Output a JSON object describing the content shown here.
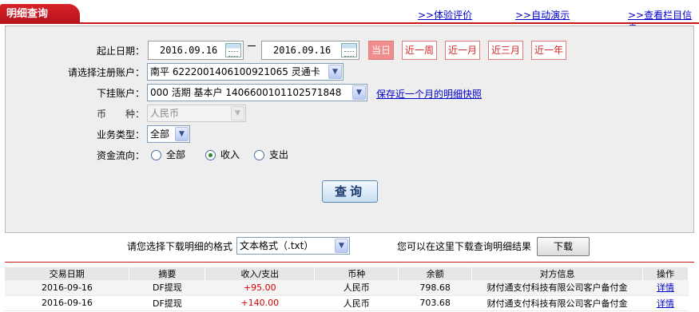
{
  "header": {
    "tab_title": "明细查询",
    "links": [
      ">>体验评价",
      ">>自动演示",
      ">>查看栏目信息"
    ]
  },
  "form": {
    "date_label": "起止日期：",
    "start_date": "2016.09.16",
    "end_date": "2016.09.16",
    "quick_ranges": [
      "当日",
      "近一周",
      "近一月",
      "近三月",
      "近一年"
    ],
    "account_label": "请选择注册账户：",
    "account_value": "南平 6222001406100921065 灵通卡",
    "sub_account_label": "下挂账户：",
    "sub_account_value": "000 活期 基本户 1406600101102571848",
    "snapshot_link": "保存近一个月的明细快照",
    "currency_label": "币　　种：",
    "currency_value": "人民币",
    "biz_type_label": "业务类型：",
    "biz_type_value": "全部",
    "flow_label": "资金流向：",
    "flow_options": [
      "全部",
      "收入",
      "支出"
    ],
    "flow_selected": "收入",
    "search_button": "查询"
  },
  "download": {
    "format_label": "请您选择下载明细的格式",
    "format_value": "文本格式（.txt）",
    "hint": "您可以在这里下载查询明细结果",
    "button": "下载"
  },
  "table": {
    "headers": [
      "交易日期",
      "摘要",
      "收入/支出",
      "币种",
      "余额",
      "对方信息",
      "操作"
    ],
    "rows": [
      [
        "2016-09-16",
        "DF提现",
        "+95.00",
        "人民币",
        "798.68",
        "财付通支付科技有限公司客户备付金",
        "详情"
      ],
      [
        "2016-09-16",
        "DF提现",
        "+140.00",
        "人民币",
        "703.68",
        "财付通支付科技有限公司客户备付金",
        "详情"
      ]
    ]
  },
  "colors": {
    "brand_red": "#c8161d",
    "link_blue": "#0000cc",
    "amount_red": "#d40000"
  }
}
